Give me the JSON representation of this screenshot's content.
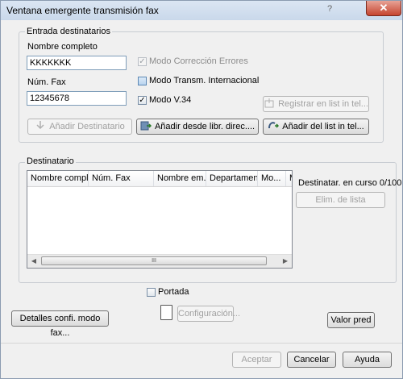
{
  "window": {
    "title": "Ventana emergente transmisión fax",
    "help_glyph": "?",
    "close_glyph": "✕"
  },
  "entry": {
    "group_label": "Entrada destinatarios",
    "name_label": "Nombre completo",
    "name_value": "KKKKKKK",
    "fax_label": "Núm. Fax",
    "fax_value": "12345678",
    "ecm_label": "Modo Corrección Errores",
    "ecm_checked": true,
    "intl_label": "Modo Transm. Internacional",
    "intl_checked": false,
    "v34_label": "Modo V.34",
    "v34_checked": true,
    "register_label": "Registrar en list in tel...",
    "add_dest_label": "Añadir Destinatario",
    "add_book_label": "Añadir desde libr. direc....",
    "add_list_label": "Añadir del list in tel..."
  },
  "dest": {
    "group_label": "Destinatario",
    "columns": [
      "Nombre compl...",
      "Núm. Fax",
      "Nombre em...",
      "Departamento",
      "Mo...",
      "M"
    ],
    "rows": [],
    "count_label": "Destinatar. en curso 0/100",
    "delete_label": "Elim. de lista",
    "scroll_left": "◀",
    "scroll_right": "▶",
    "scroll_grip": "III"
  },
  "cover": {
    "label": "Portada",
    "checked": false,
    "config_label": "Configuración..."
  },
  "buttons": {
    "fax_details": "Detalles confi. modo fax...",
    "defaults": "Valor pred",
    "ok": "Aceptar",
    "cancel": "Cancelar",
    "help": "Ayuda"
  },
  "colors": {
    "accent": "#5c88b5",
    "close": "#c5442f",
    "disabled_text": "#a0a0a0"
  }
}
